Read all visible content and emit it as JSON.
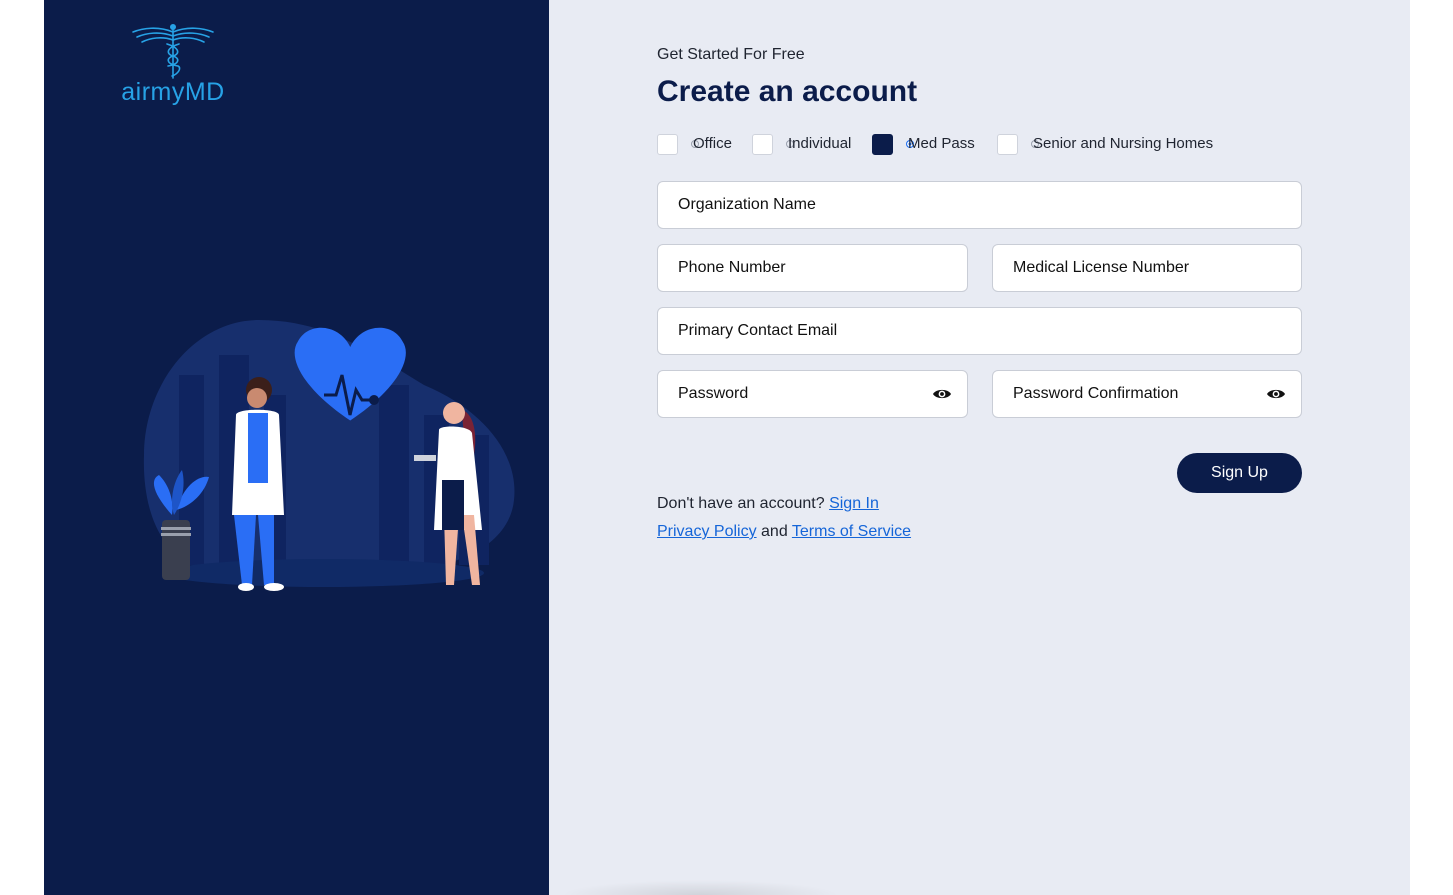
{
  "brand": {
    "name": "airmyMD"
  },
  "header": {
    "subtitle": "Get Started For Free",
    "title": "Create an account"
  },
  "account_types": [
    {
      "label": "Office",
      "selected": false
    },
    {
      "label": "Individual",
      "selected": false
    },
    {
      "label": "Med Pass",
      "selected": true
    },
    {
      "label": "Senior and Nursing Homes",
      "selected": false
    }
  ],
  "fields": {
    "organization_name": "Organization Name",
    "phone_number": "Phone Number",
    "medical_license_number": "Medical License Number",
    "primary_contact_email": "Primary Contact Email",
    "password": "Password",
    "password_confirmation": "Password Confirmation"
  },
  "actions": {
    "sign_up": "Sign Up"
  },
  "footer": {
    "no_account_text": "Don't have an account?",
    "sign_in_link": "Sign In",
    "privacy_link": "Privacy Policy",
    "and_text": "and",
    "terms_link": "Terms of Service"
  },
  "colors": {
    "navy": "#0b1c4a",
    "accent_blue": "#2a6ef5",
    "link_blue": "#1565d8",
    "form_background": "#e8ebf3"
  },
  "icons": [
    "caduceus-logo-icon",
    "eye-icon"
  ]
}
